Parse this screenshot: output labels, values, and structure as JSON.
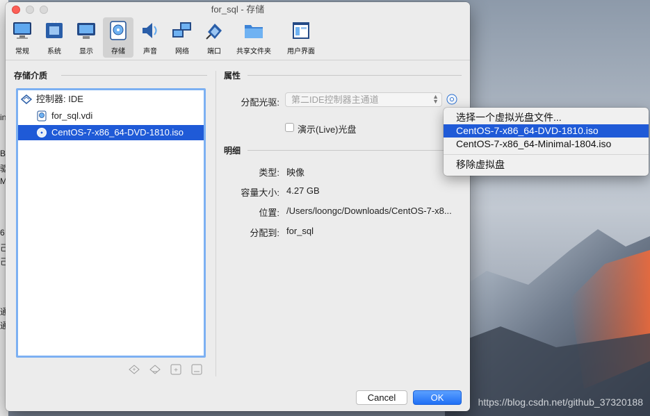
{
  "window": {
    "title": "for_sql - 存储"
  },
  "toolbar": [
    {
      "label": "常规",
      "icon": "monitor-icon"
    },
    {
      "label": "系统",
      "icon": "chip-icon"
    },
    {
      "label": "显示",
      "icon": "display-icon"
    },
    {
      "label": "存储",
      "icon": "storage-icon",
      "active": true
    },
    {
      "label": "声音",
      "icon": "speaker-icon"
    },
    {
      "label": "网络",
      "icon": "network-icon"
    },
    {
      "label": "端口",
      "icon": "port-icon"
    },
    {
      "label": "共享文件夹",
      "icon": "folder-icon"
    },
    {
      "label": "用户界面",
      "icon": "ui-icon"
    }
  ],
  "storage": {
    "section_title": "存储介质",
    "tree": [
      {
        "label": "控制器: IDE",
        "icon": "controller-icon",
        "level": 0
      },
      {
        "label": "for_sql.vdi",
        "icon": "disk-icon",
        "level": 1
      },
      {
        "label": "CentOS-7-x86_64-DVD-1810.iso",
        "icon": "optical-disc-icon",
        "level": 1,
        "selected": true
      }
    ]
  },
  "attributes": {
    "section_title": "属性",
    "drive_label": "分配光驱:",
    "drive_value": "第二IDE控制器主通道",
    "live_cd_label": "演示(Live)光盘"
  },
  "details": {
    "section_title": "明细",
    "type_label": "类型:",
    "type_value": "映像",
    "size_label": "容量大小:",
    "size_value": "4.27 GB",
    "location_label": "位置:",
    "location_value": "/Users/loongc/Downloads/CentOS-7-x8...",
    "attached_label": "分配到:",
    "attached_value": "for_sql"
  },
  "buttons": {
    "cancel": "Cancel",
    "ok": "OK"
  },
  "menu": {
    "items": [
      "选择一个虚拟光盘文件...",
      "CentOS-7-x86_64-DVD-1810.iso",
      "CentOS-7-x86_64-Minimal-1804.iso"
    ],
    "highlighted": 1,
    "remove": "移除虚拟盘"
  },
  "watermark": "https://blog.csdn.net/github_37320188",
  "background_fragments": [
    "in",
    "B",
    "驱",
    "M",
    "6",
    "己",
    "己",
    "通",
    "通"
  ],
  "colors": {
    "accent": "#1f5ad7",
    "focus_ring": "#7cb0f2",
    "close": "#fc5f57"
  }
}
